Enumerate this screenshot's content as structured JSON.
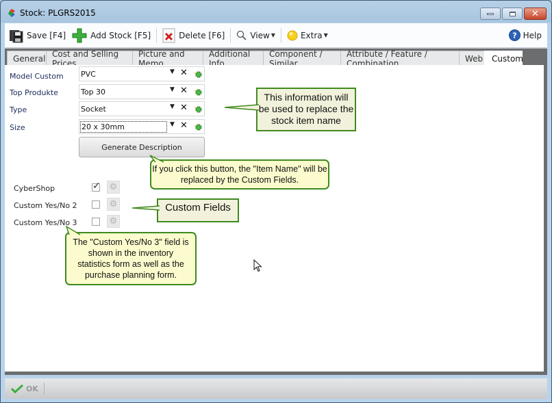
{
  "window": {
    "title": "Stock: PLGRS2015",
    "controls": {
      "minimize": "minimize",
      "maximize": "maximize",
      "close": "close"
    }
  },
  "toolbar": {
    "save_label": "Save [F4]",
    "add_stock_label": "Add Stock [F5]",
    "delete_label": "Delete [F6]",
    "view_label": "View",
    "extra_label": "Extra",
    "help_label": "Help"
  },
  "tabs": [
    {
      "label": "General",
      "active": false
    },
    {
      "label": "Cost and Selling Prices",
      "active": false
    },
    {
      "label": "Picture and Memo",
      "active": false
    },
    {
      "label": "Additional Info",
      "active": false
    },
    {
      "label": "Component / Similar",
      "active": false
    },
    {
      "label": "Attribute / Feature / Combination",
      "active": false
    },
    {
      "label": "Web",
      "active": false
    },
    {
      "label": "Custom",
      "active": true
    }
  ],
  "custom_fields": [
    {
      "label": "Model Custom",
      "value": "PVC"
    },
    {
      "label": "Top Produkte",
      "value": "Top 30"
    },
    {
      "label": "Type",
      "value": "Socket"
    },
    {
      "label": "Size",
      "value": "20 x 30mm",
      "focused": true
    }
  ],
  "generate_button_label": "Generate Description",
  "checkboxes": [
    {
      "label": "CyberShop",
      "checked": true
    },
    {
      "label": "Custom Yes/No 2",
      "checked": false
    },
    {
      "label": "Custom Yes/No 3",
      "checked": false
    }
  ],
  "callouts": {
    "item_name_info": "This information will be used to replace the stock item name",
    "generate_info": "If you click this button, the \"Item Name\" will be replaced by the Custom Fields.",
    "custom_fields": "Custom Fields",
    "yesno3_info": "The \"Custom Yes/No 3\" field is shown in the inventory statistics form as well as the purchase planning form."
  },
  "status": {
    "ok_label": "OK"
  },
  "colors": {
    "callout_border": "#3e8a1e",
    "callout_fill": "#f2f2dc",
    "bubble_fill": "#fbfbcd",
    "label_blue": "#1a2a5a"
  }
}
